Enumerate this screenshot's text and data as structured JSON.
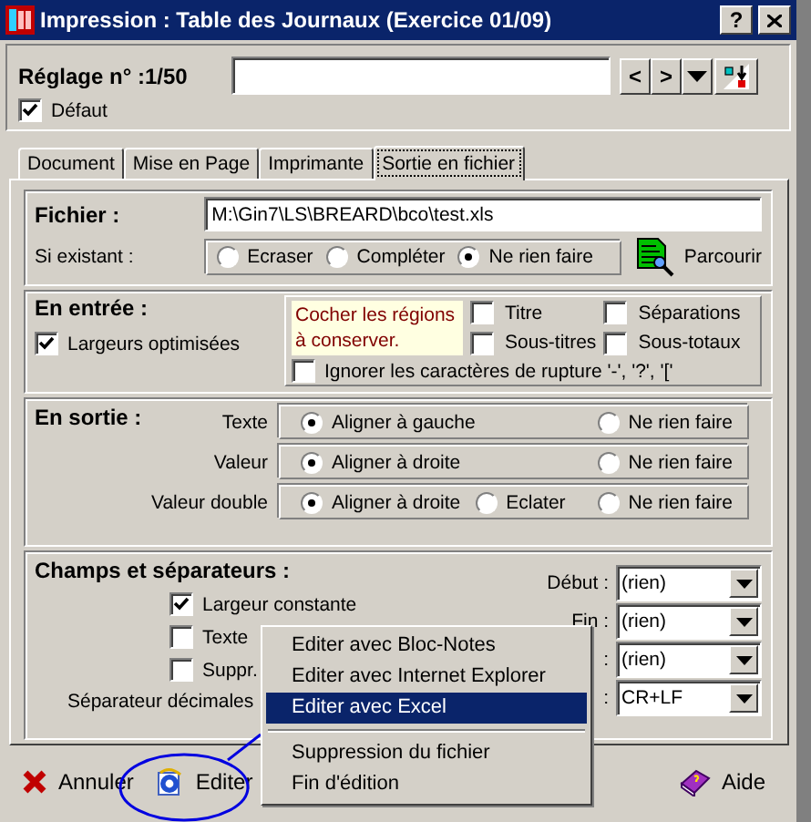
{
  "window": {
    "title": "Impression : Table des Journaux (Exercice 01/09)",
    "help": "?"
  },
  "setting": {
    "label": "Réglage n° :1/50",
    "prev": "<",
    "next": ">",
    "default": {
      "label": "Défaut",
      "checked": true
    }
  },
  "tabs": [
    {
      "label": "Document",
      "selected": false
    },
    {
      "label": "Mise en Page",
      "selected": false
    },
    {
      "label": "Imprimante",
      "selected": false
    },
    {
      "label": "Sortie en fichier",
      "selected": true
    }
  ],
  "file": {
    "label": "Fichier :",
    "path": "M:\\Gin7\\LS\\BREARD\\bco\\test.xls",
    "if_exists_label": "Si existant :",
    "options": [
      {
        "label": "Ecraser",
        "selected": false
      },
      {
        "label": "Compléter",
        "selected": false
      },
      {
        "label": "Ne rien faire",
        "selected": true
      }
    ],
    "browse": "Parcourir"
  },
  "input": {
    "title": "En entrée :",
    "optimized": {
      "label": "Largeurs optimisées",
      "checked": true
    },
    "hint": "Cocher les régions à conserver.",
    "regions": [
      {
        "label": "Titre",
        "checked": false
      },
      {
        "label": "Séparations",
        "checked": false
      },
      {
        "label": "Sous-titres",
        "checked": false
      },
      {
        "label": "Sous-totaux",
        "checked": false
      }
    ],
    "ignore": {
      "label": "Ignorer les caractères de rupture '-', '?', '['",
      "checked": false
    }
  },
  "output": {
    "title": "En sortie :",
    "rows": [
      {
        "label": "Texte",
        "options": [
          {
            "label": "Aligner à gauche",
            "selected": true
          },
          {
            "label": "Ne rien faire",
            "selected": false
          }
        ]
      },
      {
        "label": "Valeur",
        "options": [
          {
            "label": "Aligner à droite",
            "selected": true
          },
          {
            "label": "Ne rien faire",
            "selected": false
          }
        ]
      },
      {
        "label": "Valeur double",
        "options": [
          {
            "label": "Aligner à droite",
            "selected": true
          },
          {
            "label": "Eclater",
            "selected": false
          },
          {
            "label": "Ne rien faire",
            "selected": false
          }
        ]
      }
    ]
  },
  "fields": {
    "title": "Champs et séparateurs :",
    "checkboxes": [
      {
        "label": "Largeur constante",
        "checked": true
      },
      {
        "label": "Texte",
        "checked": false
      },
      {
        "label": "Suppr.",
        "checked": false
      }
    ],
    "decimal_label": "Séparateur décimales",
    "selects": [
      {
        "label": "Début :",
        "value": "(rien)"
      },
      {
        "label": "Fin :",
        "value": "(rien)"
      },
      {
        "label": ":",
        "value": "(rien)"
      },
      {
        "label": ":",
        "value": "CR+LF"
      }
    ]
  },
  "buttons": [
    {
      "kind": "cancel",
      "label": "Annuler"
    },
    {
      "kind": "edit",
      "label": "Editer"
    },
    {
      "kind": "help",
      "label": "Aide"
    }
  ],
  "menu": {
    "items": [
      {
        "kind": "item",
        "label": "Editer avec Bloc-Notes",
        "selected": false
      },
      {
        "kind": "item",
        "label": "Editer avec Internet Explorer",
        "selected": false
      },
      {
        "kind": "item",
        "label": "Editer avec Excel",
        "selected": true
      },
      {
        "kind": "separator"
      },
      {
        "kind": "item",
        "label": "Suppression du fichier",
        "selected": false
      },
      {
        "kind": "item",
        "label": "Fin d'édition",
        "selected": false
      }
    ]
  }
}
